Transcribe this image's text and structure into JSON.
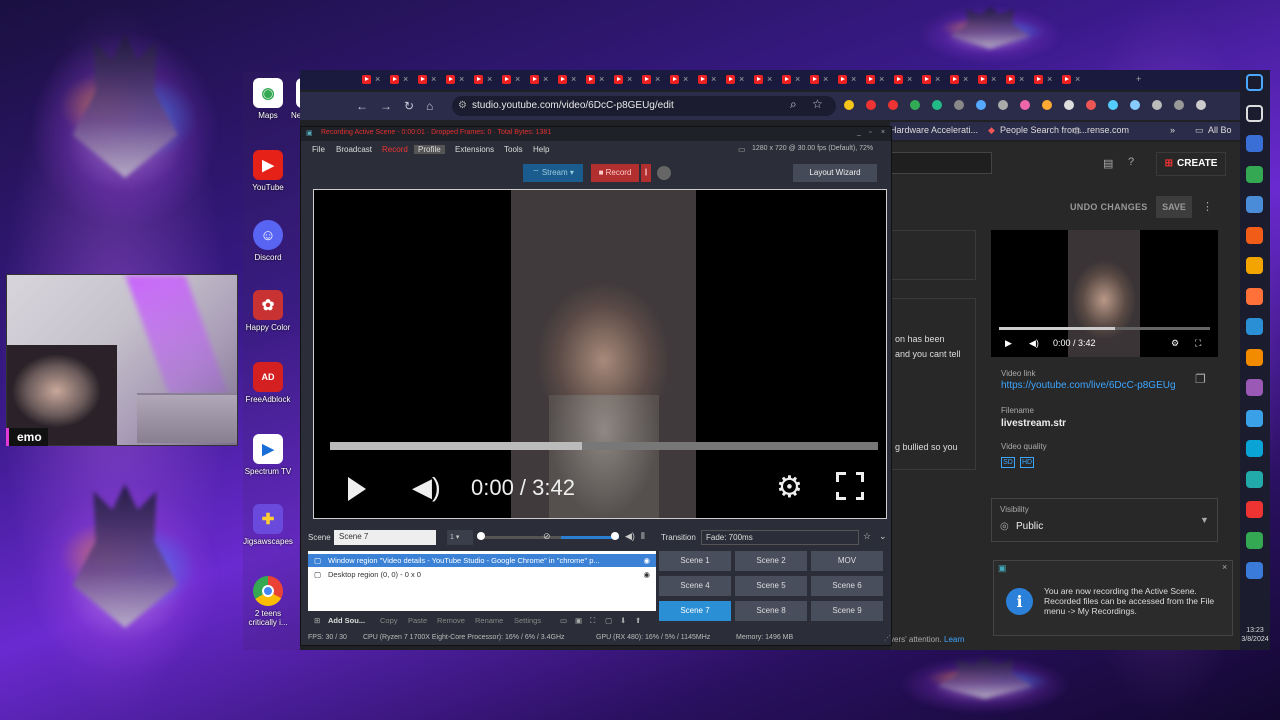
{
  "webcam": {
    "name": "emo"
  },
  "desktop_icons": [
    {
      "label": "Maps",
      "icon": "map-pin-icon",
      "color": "#ffffff"
    },
    {
      "label": "NewsBreak",
      "icon": "news-icon",
      "color": "#e22222"
    },
    {
      "label": "YouTube",
      "icon": "youtube-icon",
      "color": "#e62117"
    },
    {
      "label": "Discord",
      "icon": "discord-icon",
      "color": "#5865f2"
    },
    {
      "label": "Happy Color",
      "icon": "happy-color-icon",
      "color": "#c83232"
    },
    {
      "label": "FreeAdblock",
      "icon": "adblock-icon",
      "color": "#d42020"
    },
    {
      "label": "Spectrum TV",
      "icon": "spectrum-icon",
      "color": "#ffffff"
    },
    {
      "label": "Jigsawscapes",
      "icon": "puzzle-icon",
      "color": "#6a4adc"
    },
    {
      "label": "2 teens critically i...",
      "icon": "chrome-icon",
      "color": "#34a853"
    }
  ],
  "browser": {
    "url": "studio.youtube.com/video/6DcC-p8GEUg/edit",
    "bookmarks": [
      "Hardware Accelerati...",
      "People Search from...",
      "rense.com",
      "All Bo"
    ],
    "studio": {
      "create_label": "CREATE",
      "undo_label": "UNDO CHANGES",
      "save_label": "SAVE",
      "left_snippets": [
        "on has been",
        "and you cant tell",
        "g bullied so you"
      ],
      "player_time": "0:00 / 3:42",
      "video_link_label": "Video link",
      "video_link": "https://youtube.com/live/6DcC-p8GEUg",
      "filename_label": "Filename",
      "filename": "livestream.str",
      "quality_label": "Video quality",
      "quality_badges": [
        "SD",
        "HD"
      ],
      "visibility_label": "Visibility",
      "visibility_value": "Public",
      "footer_snippet": "vers' attention.",
      "footer_link": "Learn"
    }
  },
  "toast": {
    "text": "You are now recording the Active Scene. Recorded files can be accessed from the File menu -> My Recordings."
  },
  "obs": {
    "title": "Recording Active Scene - 0:00:01 · Dropped Frames: 0 · Total Bytes: 1381",
    "menu": [
      "File",
      "Broadcast",
      "Record",
      "Profile",
      "Extensions",
      "Tools",
      "Help"
    ],
    "resolution": "1280 x 720 @ 30.00 fps (Default), 72%",
    "stream_label": "Stream",
    "record_label": "Record",
    "layout_wizard_label": "Layout Wizard",
    "preview_time": "0:00 / 3:42",
    "scene_label": "Scene",
    "scene_value": "Scene 7",
    "scene_index": "1",
    "transition_label": "Transition",
    "transition_value": "Fade: 700ms",
    "sources": [
      {
        "name": "Window region \"Video details - YouTube Studio - Google Chrome\" in \"chrome\" p...",
        "selected": true
      },
      {
        "name": "Desktop region (0, 0) - 0 x 0",
        "selected": false
      }
    ],
    "source_tools": [
      "Add Sou...",
      "Copy",
      "Paste",
      "Remove",
      "Rename",
      "Settings"
    ],
    "scenes": [
      "Scene 1",
      "Scene 2",
      "MOV",
      "Scene 4",
      "Scene 5",
      "Scene 6",
      "Scene 7",
      "Scene 8",
      "Scene 9"
    ],
    "active_scene": "Scene 7",
    "status": {
      "fps": "FPS: 30 / 30",
      "cpu": "CPU (Ryzen 7 1700X Eight-Core Processor):  16% / 6% / 3.4GHz",
      "gpu": "GPU (RX 480):  16% / 5% / 1145MHz",
      "memory": "Memory:  1496 MB"
    }
  },
  "taskbar": {
    "time": "13:23",
    "date": "3/8/2024"
  }
}
